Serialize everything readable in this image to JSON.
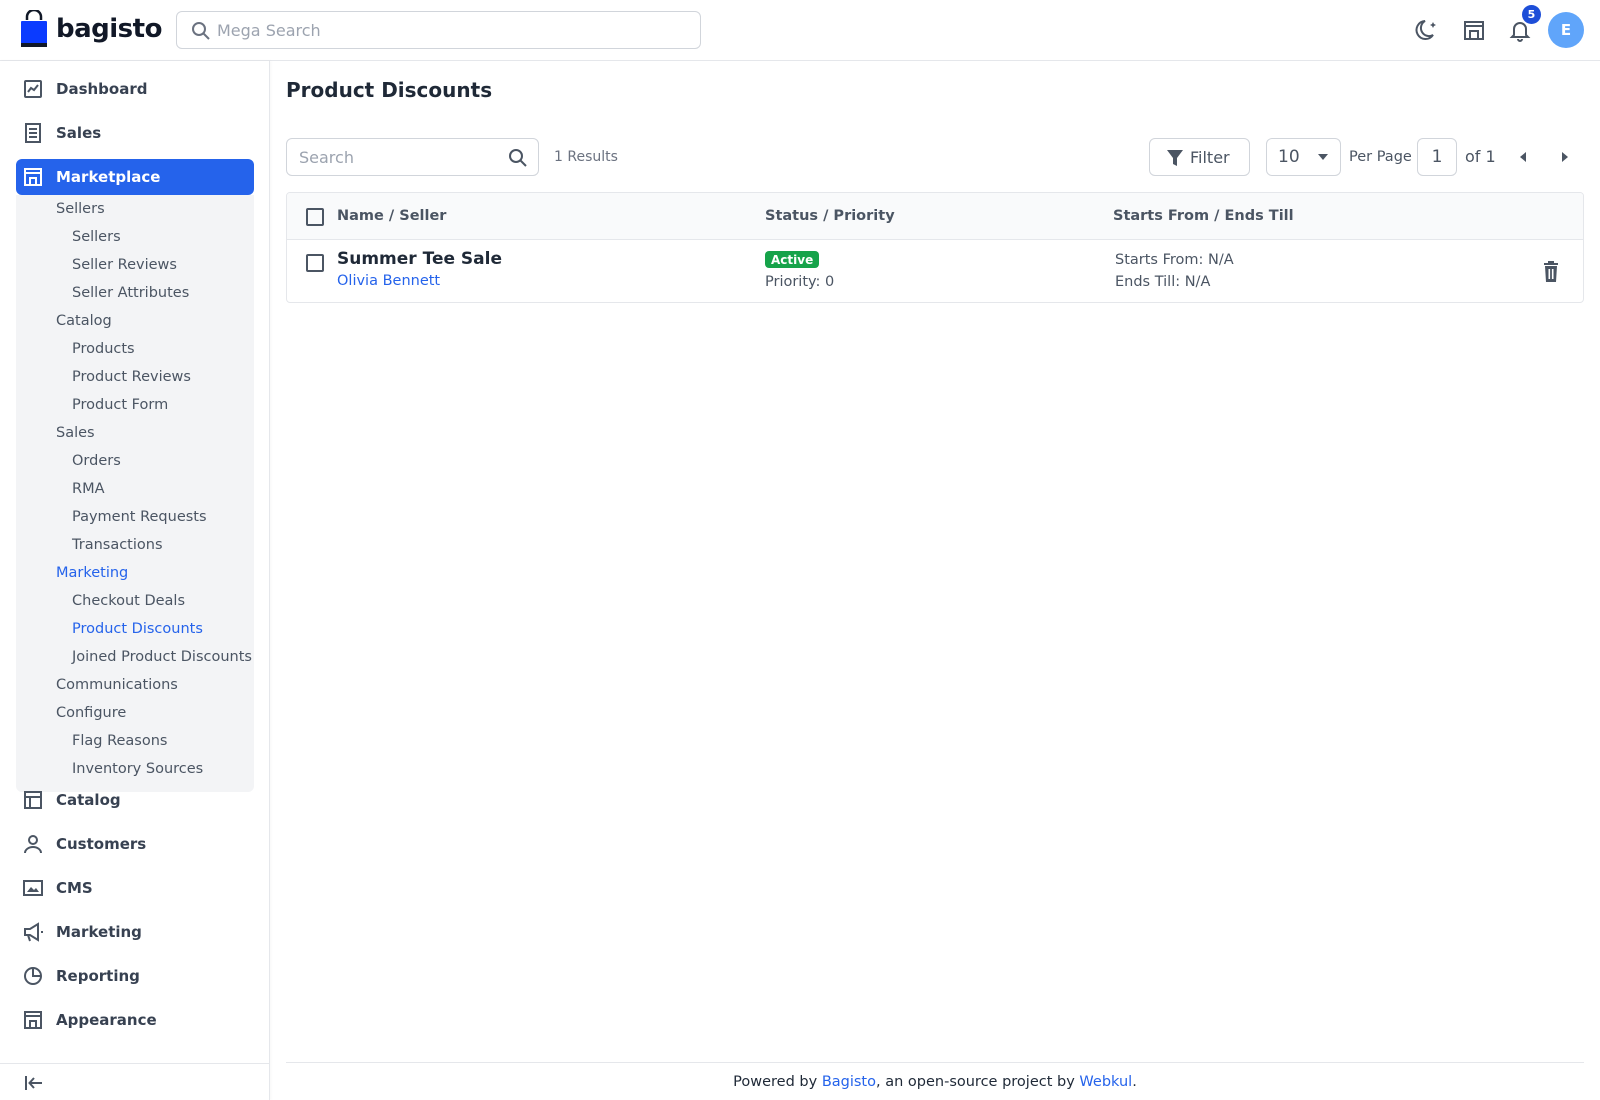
{
  "header": {
    "logo_text": "bagisto",
    "search_placeholder": "Mega Search",
    "notification_count": "5",
    "avatar_initial": "E",
    "icons": [
      "moon-icon",
      "store-icon",
      "bell-icon"
    ]
  },
  "sidebar": {
    "top_items": [
      {
        "label": "Dashboard",
        "icon": "dashboard-icon"
      },
      {
        "label": "Sales",
        "icon": "receipt-icon"
      },
      {
        "label": "Marketplace",
        "icon": "store-icon",
        "active": true
      }
    ],
    "marketplace_menu": [
      {
        "label": "Sellers",
        "level": 1
      },
      {
        "label": "Sellers",
        "level": 2
      },
      {
        "label": "Seller Reviews",
        "level": 2
      },
      {
        "label": "Seller Attributes",
        "level": 2
      },
      {
        "label": "Catalog",
        "level": 1
      },
      {
        "label": "Products",
        "level": 2
      },
      {
        "label": "Product Reviews",
        "level": 2
      },
      {
        "label": "Product Form",
        "level": 2
      },
      {
        "label": "Sales",
        "level": 1
      },
      {
        "label": "Orders",
        "level": 2
      },
      {
        "label": "RMA",
        "level": 2
      },
      {
        "label": "Payment Requests",
        "level": 2
      },
      {
        "label": "Transactions",
        "level": 2
      },
      {
        "label": "Marketing",
        "level": 1,
        "active": true
      },
      {
        "label": "Checkout Deals",
        "level": 2
      },
      {
        "label": "Product Discounts",
        "level": 2,
        "active": true
      },
      {
        "label": "Joined Product Discounts",
        "level": 2
      },
      {
        "label": "Communications",
        "level": 1
      },
      {
        "label": "Configure",
        "level": 1
      },
      {
        "label": "Flag Reasons",
        "level": 2
      },
      {
        "label": "Inventory Sources",
        "level": 2
      }
    ],
    "bottom_items": [
      {
        "label": "Catalog",
        "icon": "catalog-icon"
      },
      {
        "label": "Customers",
        "icon": "user-icon"
      },
      {
        "label": "CMS",
        "icon": "cms-icon"
      },
      {
        "label": "Marketing",
        "icon": "megaphone-icon"
      },
      {
        "label": "Reporting",
        "icon": "pie-chart-icon"
      },
      {
        "label": "Appearance",
        "icon": "store-icon"
      }
    ]
  },
  "main": {
    "title": "Product Discounts",
    "search_placeholder": "Search",
    "results": "1 Results",
    "filter_label": "Filter",
    "per_page_value": "10",
    "per_page_label": "Per Page",
    "page_value": "1",
    "page_of": "of 1",
    "table": {
      "columns": [
        "Name / Seller",
        "Status / Priority",
        "Starts From / Ends Till"
      ],
      "rows": [
        {
          "name": "Summer Tee Sale",
          "seller": "Olivia Bennett",
          "status": "Active",
          "priority": "Priority: 0",
          "starts": "Starts From: N/A",
          "ends": "Ends Till: N/A"
        }
      ]
    }
  },
  "footer": {
    "prefix": "Powered by ",
    "link1": "Bagisto",
    "middle": ", an open-source project by ",
    "link2": "Webkul",
    "suffix": "."
  },
  "colors": {
    "accent": "#2563eb",
    "status_active": "#16a34a",
    "badge": "#1d4ed8",
    "avatar": "#60a5fa"
  }
}
